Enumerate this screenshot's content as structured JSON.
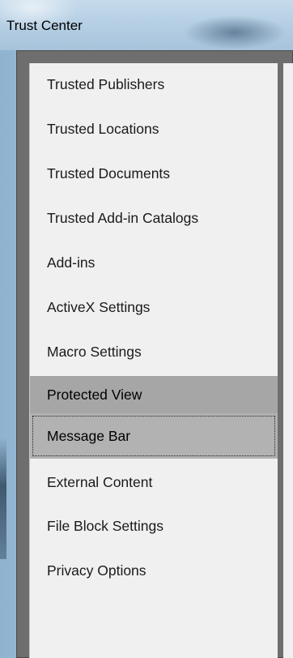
{
  "window": {
    "title": "Trust Center"
  },
  "sidebar": {
    "items": [
      {
        "label": "Trusted Publishers",
        "state": "normal"
      },
      {
        "label": "Trusted Locations",
        "state": "normal"
      },
      {
        "label": "Trusted Documents",
        "state": "normal"
      },
      {
        "label": "Trusted Add-in Catalogs",
        "state": "normal"
      },
      {
        "label": "Add-ins",
        "state": "normal"
      },
      {
        "label": "ActiveX Settings",
        "state": "normal"
      },
      {
        "label": "Macro Settings",
        "state": "normal"
      },
      {
        "label": "Protected View",
        "state": "selected"
      },
      {
        "label": "Message Bar",
        "state": "focused"
      },
      {
        "label": "External Content",
        "state": "normal"
      },
      {
        "label": "File Block Settings",
        "state": "normal"
      },
      {
        "label": "Privacy Options",
        "state": "normal"
      }
    ]
  },
  "colors": {
    "selected_bg": "#a6a6a6",
    "focused_bg": "#b2b2b2",
    "pane_bg": "#f0f0f0",
    "frame": "#6e6e6e"
  }
}
